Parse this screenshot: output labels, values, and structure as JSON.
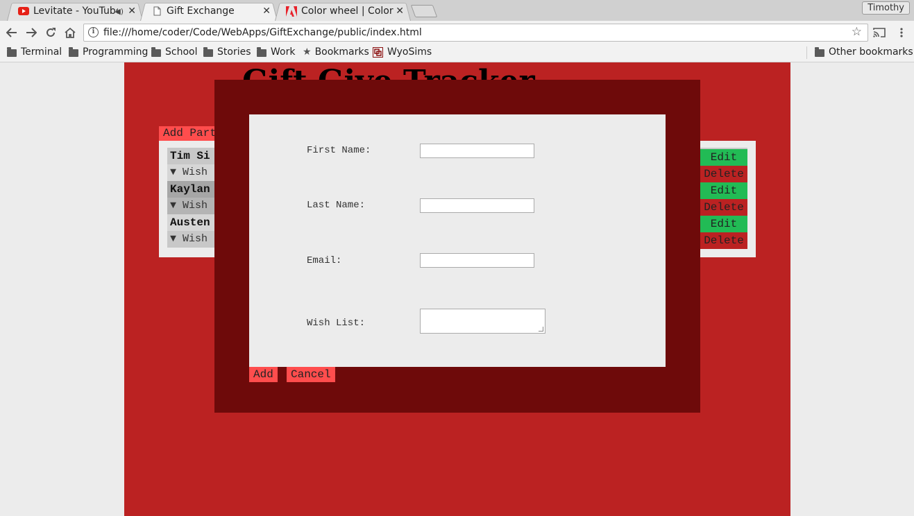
{
  "browser": {
    "tabs": [
      {
        "title": "Levitate - YouTube",
        "icon": "youtube-icon"
      },
      {
        "title": "Gift Exchange",
        "icon": "page-icon"
      },
      {
        "title": "Color wheel | Color sc",
        "icon": "adobe-icon"
      }
    ],
    "profile": "Timothy",
    "url": "file:///home/coder/Code/WebApps/GiftExchange/public/index.html",
    "bookmarks": [
      "Terminal",
      "Programming",
      "School",
      "Stories",
      "Work",
      "Bookmarks",
      "WyoSims"
    ],
    "other_bookmarks": "Other bookmarks"
  },
  "page": {
    "title": "Gift Give Tracker",
    "add_party_label": "Add Party",
    "people": [
      {
        "name": "Tim Si",
        "wish": "▼ Wish"
      },
      {
        "name": "Kaylan",
        "wish": "▼ Wish"
      },
      {
        "name": "Austen",
        "wish": "▼ Wish"
      }
    ],
    "edit_label": "Edit",
    "delete_label": "Delete"
  },
  "modal": {
    "first_name_label": "First Name:",
    "last_name_label": "Last Name:",
    "email_label": "Email:",
    "wish_list_label": "Wish List:",
    "add_label": "Add",
    "cancel_label": "Cancel"
  },
  "colors": {
    "page_bg": "#bb2222",
    "overlay": "#6e0a0a",
    "button_red": "#ff4d4d",
    "edit_green": "#22bb55"
  }
}
